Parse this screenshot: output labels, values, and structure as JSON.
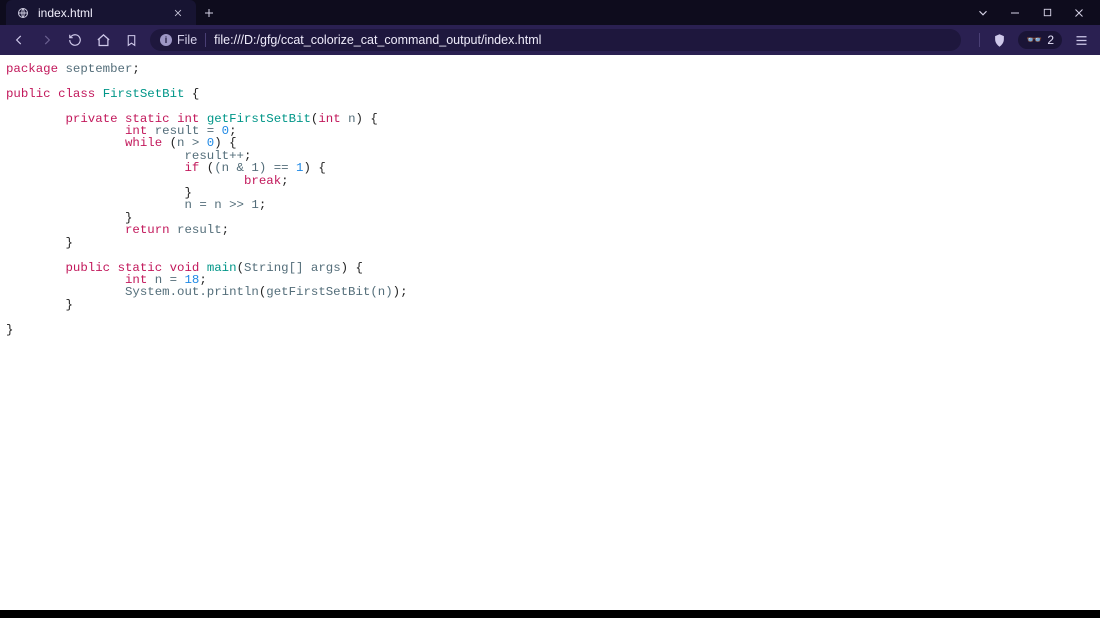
{
  "tab": {
    "label": "index.html"
  },
  "address": {
    "scheme_label": "File",
    "url": "file:///D:/gfg/ccat_colorize_cat_command_output/index.html"
  },
  "counter": "2",
  "code": {
    "pkg_kw": "package",
    "pkg_name": "september",
    "semi": ";",
    "public": "public",
    "class": "class",
    "class_name": "FirstSetBit",
    "lbrace": "{",
    "rbrace": "}",
    "private": "private",
    "static": "static",
    "int_kw": "int",
    "method1": "getFirstSetBit",
    "lparen": "(",
    "rparen": ")",
    "param_n": "n",
    "result_var": "result",
    "eq": " = ",
    "zero": "0",
    "while_kw": "while",
    "gt": " > ",
    "pp": "result++",
    "if_kw": "if",
    "cond_amp": "(n & 1)",
    "eqeq": " == ",
    "one": "1",
    "break_kw": "break",
    "shift": "n = n >> 1",
    "return_kw": "return",
    "void_kw": "void",
    "main": "main",
    "main_arg": "String[] args",
    "n18": "18",
    "sys": "System.out.println",
    "call": "getFirstSetBit(n)"
  }
}
